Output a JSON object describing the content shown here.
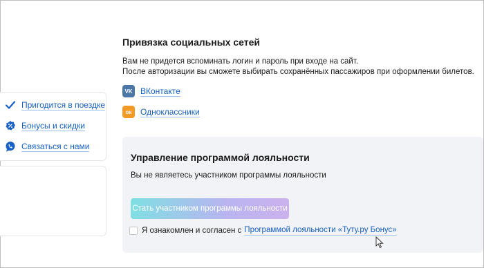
{
  "sidebar": {
    "items": [
      {
        "label": "Пригодится в поездке",
        "icon": "checkmark-icon"
      },
      {
        "label": "Бонусы и скидки",
        "icon": "discount-badge-icon"
      },
      {
        "label": "Связаться с нами",
        "icon": "chat-bubble-icon"
      }
    ]
  },
  "social": {
    "title": "Привязка социальных сетей",
    "desc_line1": "Вам не придется вспоминать логин и пароль при входе на сайт.",
    "desc_line2": "После авторизации вы сможете выбирать сохранённых пассажиров при оформлении билетов.",
    "networks": [
      {
        "label": "ВКонтакте",
        "icon_text": "VK",
        "color": "#4a76a8"
      },
      {
        "label": "Одноклассники",
        "icon_text": "ок",
        "color": "#f59a23"
      }
    ]
  },
  "loyalty": {
    "title": "Управление программой лояльности",
    "status": "Вы не являетесь участником программы лояльности",
    "join_button": "Стать участником программы лояльности",
    "agree_text": "Я ознакомлен и согласен с",
    "agree_link": "Программой лояльности «Туту.ру Бонус»"
  },
  "colors": {
    "link": "#1660c6",
    "panel": "#f2f3f6"
  }
}
